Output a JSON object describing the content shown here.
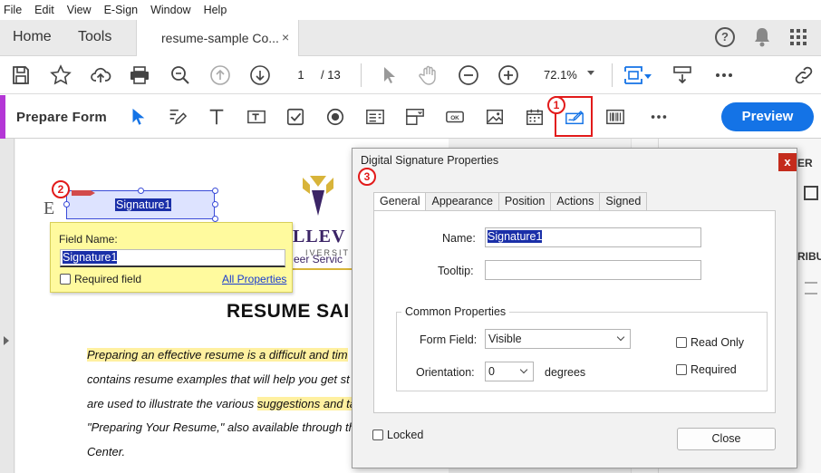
{
  "menu": [
    "File",
    "Edit",
    "View",
    "E-Sign",
    "Window",
    "Help"
  ],
  "tabs": {
    "home": "Home",
    "tools": "Tools",
    "document": "resume-sample Co...",
    "close": "×"
  },
  "toolbar": {
    "page_current": "1",
    "page_total": "/ 13",
    "zoom": "72.1%"
  },
  "form_toolbar": {
    "title": "Prepare Form",
    "preview": "Preview"
  },
  "badges": {
    "one": "1",
    "two": "2",
    "three": "3"
  },
  "document": {
    "left_letter": "E",
    "signature_field": "Signature1",
    "logo_main": "LLEV",
    "logo_sub": "IVERSIT",
    "logo_link": "eer Servic",
    "title": "RESUME SAI",
    "lines": [
      {
        "plain_before": "",
        "highlight": "Preparing an effective resume is a difficult and tim",
        "plain_after": ""
      },
      {
        "plain_before": "contains resume examples that will help you get st",
        "highlight": "",
        "plain_after": ""
      },
      {
        "plain_before": "are used to illustrate the various ",
        "highlight": "suggestions and ta",
        "plain_after": ""
      },
      {
        "plain_before": "\"Preparing Your Resume,\" also available through th",
        "highlight": "",
        "plain_after": ""
      },
      {
        "plain_before": "Center.",
        "highlight": "",
        "plain_after": ""
      }
    ]
  },
  "right_panel": {
    "label1": "ER",
    "label2": "RIBU"
  },
  "popup": {
    "label": "Field Name:",
    "value": "Signature1",
    "required": "Required field",
    "all_properties": "All Properties"
  },
  "dialog": {
    "title": "Digital Signature Properties",
    "close": "x",
    "tabs": [
      "General",
      "Appearance",
      "Position",
      "Actions",
      "Signed"
    ],
    "name_label": "Name:",
    "name_value": "Signature1",
    "tooltip_label": "Tooltip:",
    "tooltip_value": "",
    "group_title": "Common Properties",
    "form_field_label": "Form Field:",
    "form_field_value": "Visible",
    "orientation_label": "Orientation:",
    "orientation_value": "0",
    "degrees": "degrees",
    "read_only": "Read Only",
    "required": "Required",
    "locked": "Locked",
    "close_button": "Close"
  },
  "colors": {
    "accent": "#1473e6",
    "form_accent": "#b437d6",
    "annotation": "#e21a1a"
  }
}
